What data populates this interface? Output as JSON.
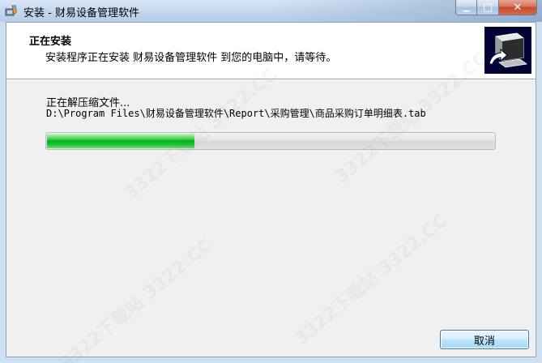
{
  "window": {
    "title": "安装 - 财易设备管理软件",
    "controls": {
      "minimize_glyph": "▁",
      "maximize_glyph": "□",
      "close_glyph": "✕"
    }
  },
  "header": {
    "title": "正在安装",
    "subtitle": "安装程序正在安装 财易设备管理软件 到您的电脑中，请等待。"
  },
  "status": {
    "label": "正在解压缩文件...",
    "filename": "D:\\Program Files\\财易设备管理软件\\Report\\采购管理\\商品采购订单明细表.tab"
  },
  "progress": {
    "fraction": 0.33,
    "color": "#06b025"
  },
  "buttons": {
    "cancel_label": "取消"
  },
  "watermark": {
    "text": "3322下载站  3322.CC"
  },
  "colors": {
    "titlebar": "#c4d8ef",
    "client_bg": "#f0f0f0",
    "header_bg": "#ffffff",
    "button_border": "#3c7fb1"
  },
  "icons": {
    "app": "installer-app-icon",
    "wizard": "computer-install-icon"
  }
}
